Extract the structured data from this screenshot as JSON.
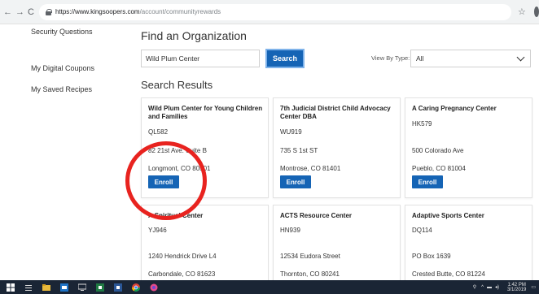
{
  "browser": {
    "back_icon": "←",
    "forward_icon": "→",
    "reload_icon": "C",
    "url_host": "https://www.kingsoopers.com",
    "url_path": "/account/communityrewards",
    "star_icon": "☆"
  },
  "sidebar": {
    "items": [
      {
        "label": "Security Questions"
      },
      {
        "label": "My Digital Coupons"
      },
      {
        "label": "My Saved Recipes"
      }
    ]
  },
  "search": {
    "heading": "Find an Organization",
    "query": "Wild Plum Center",
    "button_label": "Search",
    "view_by_label": "View By Type:",
    "type_selected": "All"
  },
  "results": {
    "heading": "Search Results",
    "enroll_label": "Enroll",
    "cards": [
      {
        "name": "Wild Plum Center for Young Children and Families",
        "code": "QL582",
        "address1": "82 21st Ave. Suite B",
        "address2": "Longmont, CO 80501",
        "has_enroll": true
      },
      {
        "name": "7th Judicial District Child Advocacy Center DBA",
        "code": "WU919",
        "address1": "735 S 1st ST",
        "address2": "Montrose, CO 81401",
        "has_enroll": true
      },
      {
        "name": "A Caring Pregnancy Center",
        "code": "HK579",
        "address1": "500 Colorado Ave",
        "address2": "Pueblo, CO 81004",
        "has_enroll": true
      },
      {
        "name": "A Spiritual Center",
        "code": "YJ946",
        "address1": "1240 Hendrick Drive L4",
        "address2": "Carbondale, CO 81623",
        "has_enroll": false
      },
      {
        "name": "ACTS Resource Center",
        "code": "HN939",
        "address1": "12534 Eudora Street",
        "address2": "Thornton, CO 80241",
        "has_enroll": false
      },
      {
        "name": "Adaptive Sports Center",
        "code": "DQ114",
        "address1": "PO Box 1639",
        "address2": "Crested Butte, CO 81224",
        "has_enroll": false
      }
    ]
  },
  "taskbar": {
    "time": "1:42 PM",
    "date": "3/1/2019"
  },
  "colors": {
    "brand_blue": "#1564b5",
    "annotation_red": "#e8231f",
    "taskbar_bg": "#1a2535"
  }
}
